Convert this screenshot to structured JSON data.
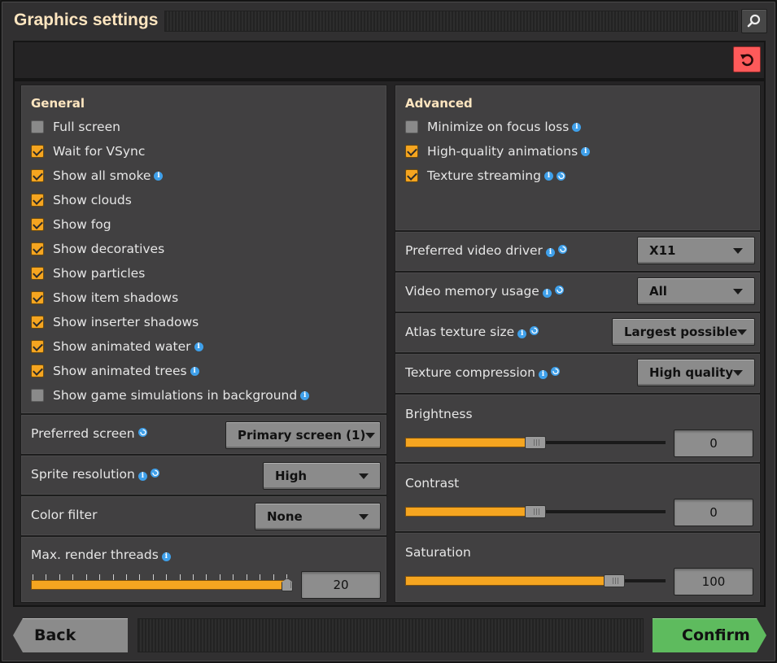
{
  "window": {
    "title": "Graphics settings"
  },
  "general": {
    "title": "General",
    "checkboxes": [
      {
        "label": "Full screen",
        "checked": false,
        "info": false
      },
      {
        "label": "Wait for VSync",
        "checked": true,
        "info": false
      },
      {
        "label": "Show all smoke",
        "checked": true,
        "info": true
      },
      {
        "label": "Show clouds",
        "checked": true,
        "info": false
      },
      {
        "label": "Show fog",
        "checked": true,
        "info": false
      },
      {
        "label": "Show decoratives",
        "checked": true,
        "info": false
      },
      {
        "label": "Show particles",
        "checked": true,
        "info": false
      },
      {
        "label": "Show item shadows",
        "checked": true,
        "info": false
      },
      {
        "label": "Show inserter shadows",
        "checked": true,
        "info": false
      },
      {
        "label": "Show animated water",
        "checked": true,
        "info": true
      },
      {
        "label": "Show animated trees",
        "checked": true,
        "info": true
      },
      {
        "label": "Show game simulations in background",
        "checked": false,
        "info": true
      }
    ],
    "preferred_screen": {
      "label": "Preferred screen",
      "value": "Primary screen (1)"
    },
    "sprite_resolution": {
      "label": "Sprite resolution",
      "value": "High"
    },
    "color_filter": {
      "label": "Color filter",
      "value": "None"
    },
    "render_threads": {
      "label": "Max. render threads",
      "value": "20",
      "fraction": 1.0
    }
  },
  "advanced": {
    "title": "Advanced",
    "checkboxes": [
      {
        "label": "Minimize on focus loss",
        "checked": false,
        "info": true
      },
      {
        "label": "High-quality animations",
        "checked": true,
        "info": true
      },
      {
        "label": "Texture streaming",
        "checked": true,
        "info": true
      }
    ],
    "video_driver": {
      "label": "Preferred video driver",
      "value": "X11"
    },
    "video_memory": {
      "label": "Video memory usage",
      "value": "All"
    },
    "atlas_size": {
      "label": "Atlas texture size",
      "value": "Largest possible"
    },
    "texture_compression": {
      "label": "Texture compression",
      "value": "High quality"
    },
    "brightness": {
      "label": "Brightness",
      "value": "0",
      "fraction": 0.5
    },
    "contrast": {
      "label": "Contrast",
      "value": "0",
      "fraction": 0.5
    },
    "saturation": {
      "label": "Saturation",
      "value": "100",
      "fraction": 0.83
    }
  },
  "footer": {
    "back": "Back",
    "confirm": "Confirm"
  },
  "colors": {
    "accent": "#f5a520",
    "confirm": "#5ebb5e",
    "reset": "#fe5a5a",
    "title": "#ffe6c0",
    "info": "#3fa0ea"
  },
  "icons": {
    "search": "magnifier-icon",
    "reset": "reset-arrow-icon",
    "info": "info-icon",
    "restart": "restart-required-icon"
  }
}
